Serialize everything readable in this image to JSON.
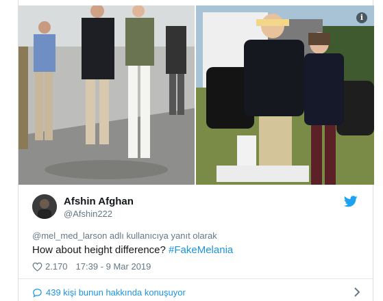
{
  "tweet": {
    "display_name": "Afshin Afghan",
    "handle": "@Afshin222",
    "reply_context": "@mel_med_larson adlı kullanıcıya yanıt olarak",
    "text": "How about height difference? ",
    "hashtag": "#FakeMelania",
    "likes": "2.170",
    "timestamp": "17:39 - 9 Mar 2019",
    "conversation": "439 kişi bunun hakkında konuşuyor"
  },
  "media": {
    "info_glyph": "i"
  },
  "colors": {
    "link": "#1b95e0",
    "secondary_text": "#657786",
    "primary_text": "#14171a"
  },
  "icons": [
    "info-icon",
    "twitter-bird-icon",
    "heart-icon",
    "comment-icon",
    "chevron-right-icon"
  ]
}
